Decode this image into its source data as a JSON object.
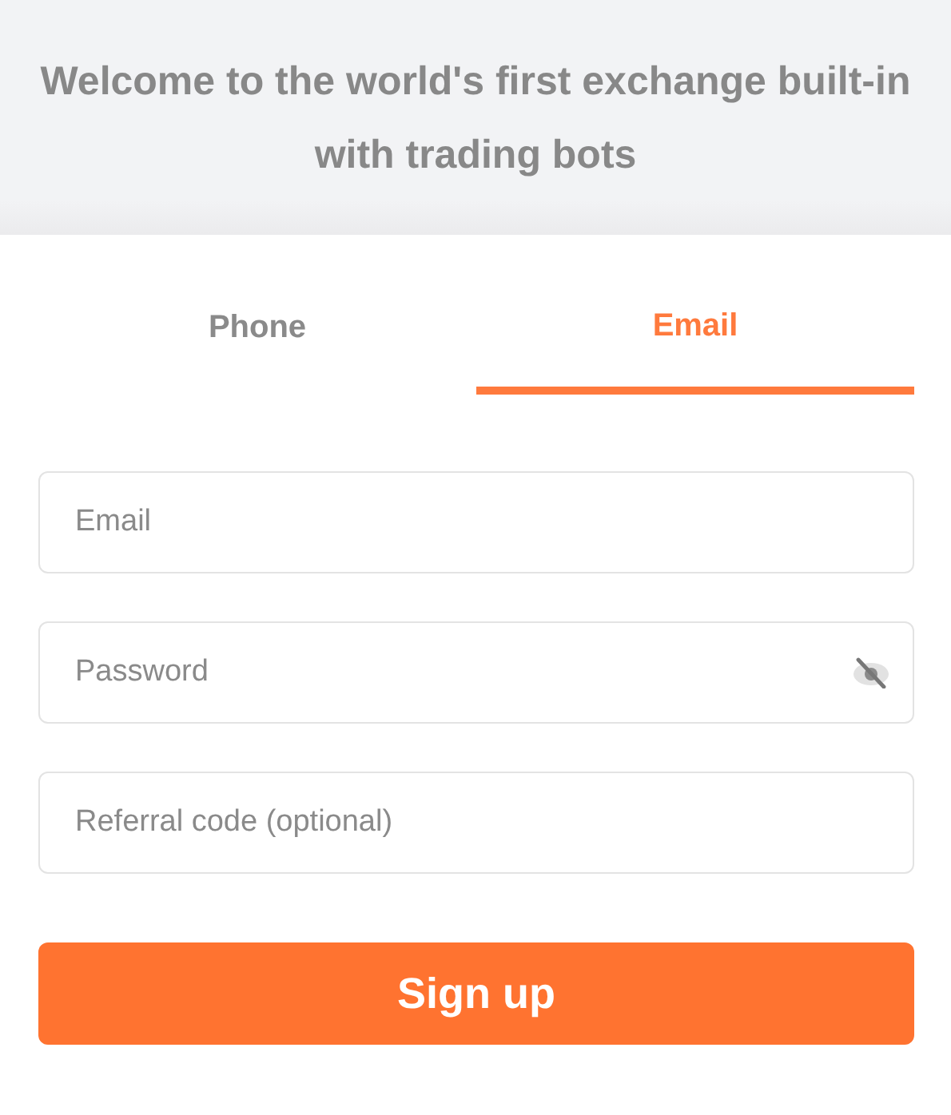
{
  "header": {
    "title": "Welcome to the world's first exchange built-in with trading bots"
  },
  "tabs": [
    {
      "label": "Phone",
      "selected": false
    },
    {
      "label": "Email",
      "selected": true
    }
  ],
  "fields": [
    {
      "placeholder": "Email",
      "kind": "text"
    },
    {
      "placeholder": "Password",
      "kind": "password"
    },
    {
      "placeholder": "Referral code (optional)",
      "kind": "text"
    }
  ],
  "submit": {
    "label": "Sign up"
  }
}
